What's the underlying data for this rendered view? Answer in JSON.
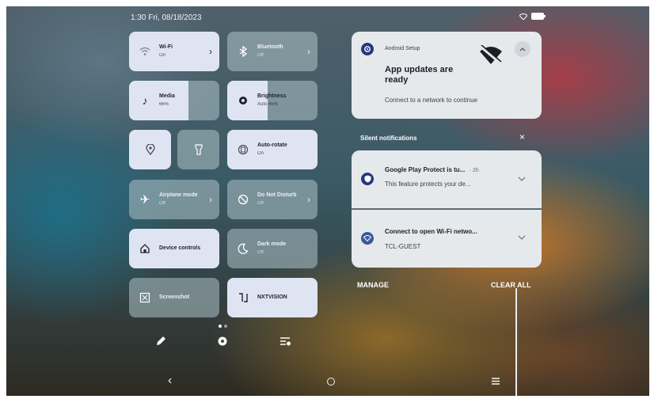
{
  "status_bar": {
    "datetime": "1:30 Fri, 08/18/2023"
  },
  "quick_settings": {
    "wifi": {
      "title": "Wi-Fi",
      "state": "On"
    },
    "bluetooth": {
      "title": "Bluetooth",
      "state": "Off"
    },
    "media": {
      "title": "Media",
      "value": "66%",
      "level": 0.66
    },
    "brightness": {
      "title": "Brightness",
      "value": "Auto 45%",
      "level": 0.45
    },
    "auto_rotate": {
      "title": "Auto-rotate",
      "state": "On"
    },
    "airplane": {
      "title": "Airplane mode",
      "state": "Off"
    },
    "dnd": {
      "title": "Do Not Disturb",
      "state": "Off"
    },
    "device_controls": {
      "title": "Device controls"
    },
    "dark_mode": {
      "title": "Dark mode",
      "state": "Off"
    },
    "screenshot": {
      "title": "Screenshot"
    },
    "nxtvision": {
      "title": "NXTVISION"
    }
  },
  "notifications": {
    "setup": {
      "app": "Android Setup",
      "title": "App updates are ready",
      "body": "Connect to a network to continue"
    },
    "silent_header": "Silent notifications",
    "silent_close": "×",
    "items": [
      {
        "title": "Google Play Protect is tu...",
        "time": "· 2h",
        "body": "This feature protects your de..."
      },
      {
        "title": "Connect to open Wi-Fi netwo...",
        "body": "TCL-GUEST"
      }
    ],
    "manage_label": "MANAGE",
    "clear_all_label": "CLEAR ALL"
  },
  "colors": {
    "accent": "#23397e",
    "tile_on": "#dfe4f3"
  }
}
